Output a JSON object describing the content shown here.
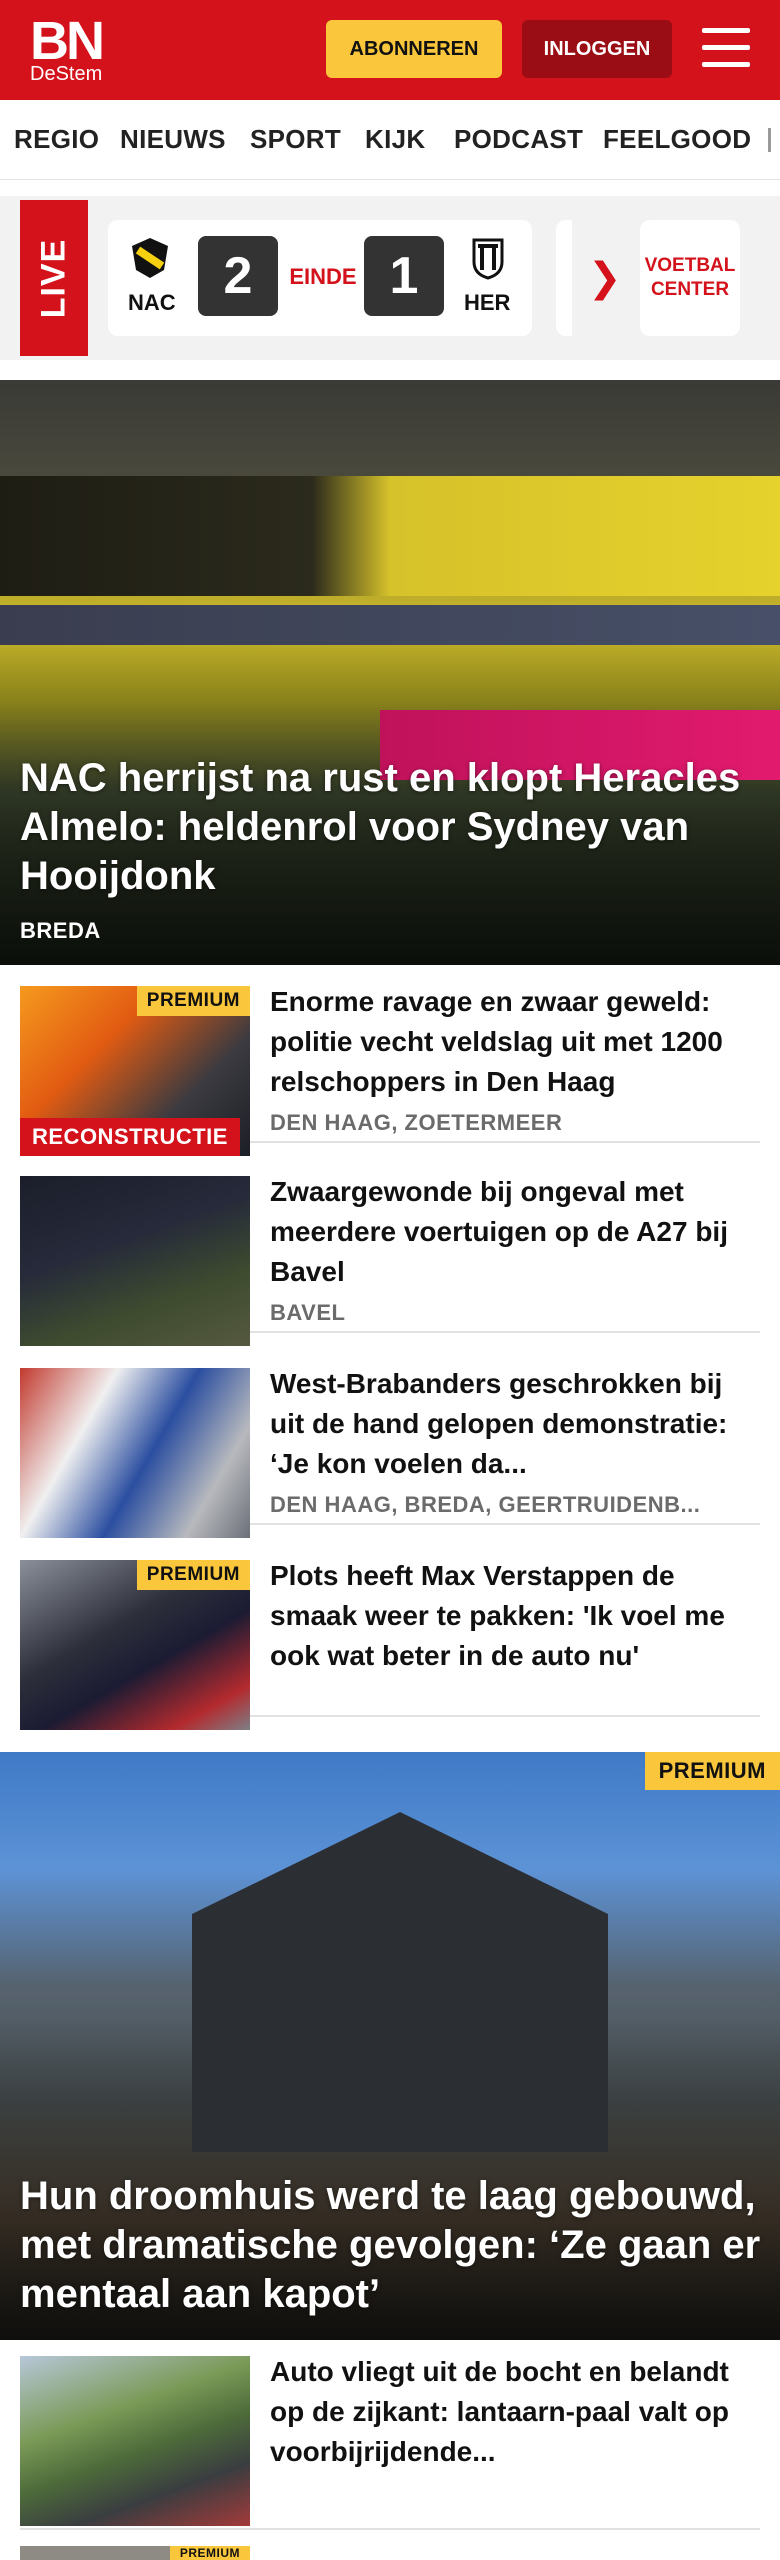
{
  "header": {
    "logo_main": "BN",
    "logo_sub": "DeStem",
    "subscribe_label": "ABONNEREN",
    "login_label": "INLOGGEN",
    "brand_color": "#d4121b",
    "accent_color": "#f9c63c"
  },
  "nav": {
    "items": [
      "REGIO",
      "NIEUWS",
      "SPORT",
      "KIJK",
      "PODCAST",
      "FEELGOOD"
    ]
  },
  "live": {
    "label": "LIVE",
    "match": {
      "home": "NAC",
      "home_score": "2",
      "status": "EINDE",
      "away_score": "1",
      "away": "HER"
    },
    "center_line1": "VOETBAL",
    "center_line2": "CENTER"
  },
  "hero": {
    "title": "NAC herrijst na rust en klopt Heracles Almelo: heldenrol voor Sydney van Hooijdonk",
    "location": "BREDA"
  },
  "articles": [
    {
      "title": "Enorme ravage en zwaar geweld: politie vecht veldslag uit met 1200 relschoppers in Den Haag",
      "location": "DEN HAAG, ZOETERMEER",
      "premium": "PREMIUM",
      "tag": "RECONSTRUCTIE"
    },
    {
      "title": "Zwaargewonde bij ongeval met meerdere voertuigen op de A27 bij Bavel",
      "location": "BAVEL"
    },
    {
      "title": "West-Brabanders geschrokken bij uit de hand gelopen demonstratie: ‘Je kon voelen da...",
      "location": "DEN HAAG, BREDA, GEERTRUIDENB..."
    },
    {
      "title": "Plots heeft Max Verstappen de smaak weer te pakken: 'Ik voel me ook wat beter in de auto nu'",
      "premium": "PREMIUM"
    }
  ],
  "feature": {
    "premium": "PREMIUM",
    "title": "Hun droomhuis werd te laag gebouwd, met dramatische gevolgen: ‘Ze gaan er mentaal aan kapot’"
  },
  "article_last": {
    "title": "Auto vliegt uit de bocht en belandt op de zijkant: lantaarn-paal valt op voorbijrijdende..."
  },
  "partial": {
    "premium": "PREMIUM"
  }
}
